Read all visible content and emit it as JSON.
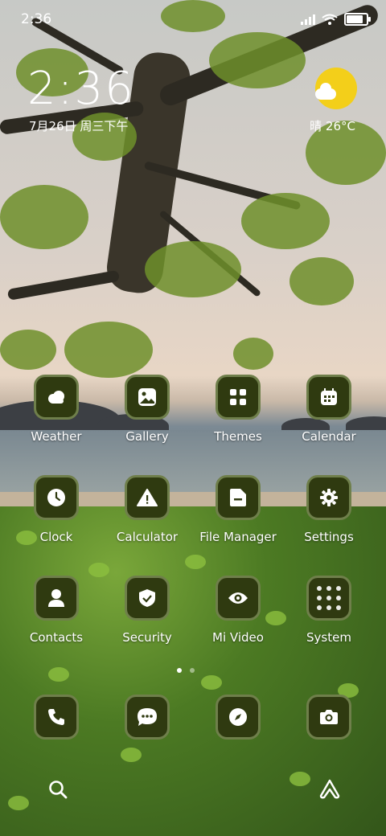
{
  "status_bar": {
    "time": "2:36",
    "battery_level": 0.9
  },
  "clock_widget": {
    "time": "2:36",
    "date": "7月26日 周三下午"
  },
  "weather_widget": {
    "text": "晴 26°C",
    "icon": "sun-cloud-icon"
  },
  "apps": [
    {
      "label": "Weather",
      "icon": "cloud-icon"
    },
    {
      "label": "Gallery",
      "icon": "image-icon"
    },
    {
      "label": "Themes",
      "icon": "grid-icon"
    },
    {
      "label": "Calendar",
      "icon": "calendar-icon"
    },
    {
      "label": "Clock",
      "icon": "clock-icon"
    },
    {
      "label": "Calculator",
      "icon": "warning-triangle-icon"
    },
    {
      "label": "File Manager",
      "icon": "folder-icon"
    },
    {
      "label": "Settings",
      "icon": "gear-icon"
    },
    {
      "label": "Contacts",
      "icon": "person-icon"
    },
    {
      "label": "Security",
      "icon": "shield-check-icon"
    },
    {
      "label": "Mi Video",
      "icon": "eye-icon"
    },
    {
      "label": "System",
      "icon": "folder-grid-icon"
    }
  ],
  "dock": [
    {
      "icon": "phone-icon"
    },
    {
      "icon": "message-icon"
    },
    {
      "icon": "compass-icon"
    },
    {
      "icon": "camera-icon"
    }
  ],
  "page_indicator": {
    "pages": 2,
    "current": 1
  },
  "bottom_bar": {
    "left_icon": "search-icon",
    "right_icon": "app-vault-icon"
  }
}
